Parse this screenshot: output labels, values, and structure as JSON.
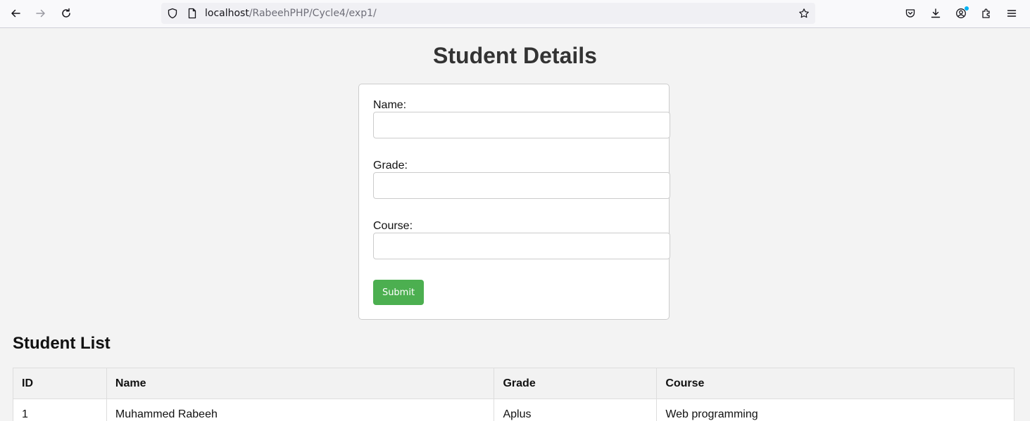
{
  "browser": {
    "url_host": "localhost",
    "url_path": "/RabeehPHP/Cycle4/exp1/"
  },
  "page": {
    "title": "Student Details",
    "form": {
      "fields": [
        {
          "label": "Name:",
          "value": ""
        },
        {
          "label": "Grade:",
          "value": ""
        },
        {
          "label": "Course:",
          "value": ""
        }
      ],
      "submit_label": "Submit"
    },
    "list_title": "Student List",
    "table": {
      "headers": [
        "ID",
        "Name",
        "Grade",
        "Course"
      ],
      "rows": [
        [
          "1",
          "Muhammed Rabeeh",
          "Aplus",
          "Web programming"
        ]
      ]
    }
  },
  "colors": {
    "submit": "#4caf50",
    "badge": "#00b3f4"
  }
}
